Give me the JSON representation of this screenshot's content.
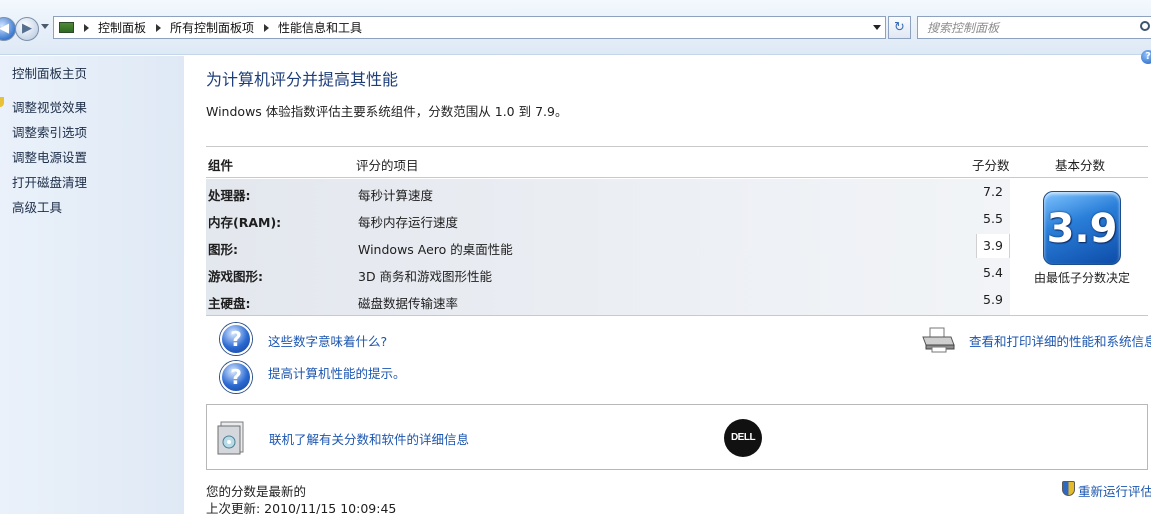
{
  "address": {
    "crumbs": [
      "控制面板",
      "所有控制面板项",
      "性能信息和工具"
    ],
    "search_placeholder": "搜索控制面板"
  },
  "sidebar": {
    "home": "控制面板主页",
    "links": [
      "调整视觉效果",
      "调整索引选项",
      "调整电源设置",
      "打开磁盘清理",
      "高级工具"
    ]
  },
  "main": {
    "title": "为计算机评分并提高其性能",
    "description": "Windows 体验指数评估主要系统组件，分数范围从 1.0 到 7.9。",
    "headers": {
      "component": "组件",
      "rated": "评分的项目",
      "subscore": "子分数",
      "basescore": "基本分数"
    },
    "rows": [
      {
        "name": "处理器:",
        "item": "每秒计算速度",
        "score": "7.2"
      },
      {
        "name": "内存(RAM):",
        "item": "每秒内存运行速度",
        "score": "5.5"
      },
      {
        "name": "图形:",
        "item": "Windows Aero 的桌面性能",
        "score": "3.9"
      },
      {
        "name": "游戏图形:",
        "item": "3D 商务和游戏图形性能",
        "score": "5.4"
      },
      {
        "name": "主硬盘:",
        "item": "磁盘数据传输速率",
        "score": "5.9"
      }
    ],
    "base_score": "3.9",
    "base_caption": "由最低子分数决定",
    "links": {
      "what_mean": "这些数字意味着什么?",
      "tips": "提高计算机性能的提示。",
      "print_details": "查看和打印详细的性能和系统信息",
      "online": "联机了解有关分数和软件的详细信息",
      "rerun": "重新运行评估"
    },
    "dell_logo_text": "DELL",
    "status": {
      "current": "您的分数是最新的",
      "last_update": "上次更新: 2010/11/15 10:09:45"
    }
  }
}
